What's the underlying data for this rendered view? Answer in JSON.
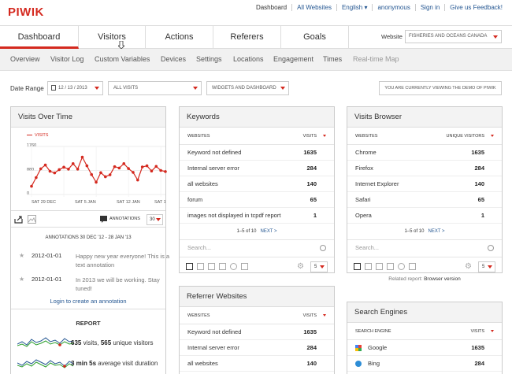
{
  "app": {
    "logo": "PIWIK"
  },
  "top_links": [
    "Dashboard",
    "All Websites",
    "English",
    "anonymous",
    "Sign in",
    "Give us Feedback!"
  ],
  "main_tabs": [
    "Dashboard",
    "Visitors",
    "Actions",
    "Referers",
    "Goals"
  ],
  "website": {
    "label": "Website",
    "value": "FISHERIES AND OCEANS CANADA"
  },
  "sub_tabs": [
    "Overview",
    "Visitor Log",
    "Custom Variables",
    "Devices",
    "Settings",
    "Locations",
    "Engagement",
    "Times",
    "Real-time Map"
  ],
  "date_range": {
    "label": "Date Range",
    "date": "12 / 13 / 2013",
    "segment": "ALL VISITS",
    "mode": "WIDGETS AND DASHBOARD",
    "demo_notice": "YOU ARE CURRENTLY VIEWING THE DEMO OF PIWIK"
  },
  "visits_over_time": {
    "title": "Visits Over Time",
    "annotations_label": "ANNOTATIONS",
    "period_value": "30",
    "annotations_title": "ANNOTATIONS 30 DEC '12 - 28 JAN '13",
    "annotations": [
      {
        "date": "2012-01-01",
        "text": "Happy new year everyone! This is a text annotation"
      },
      {
        "date": "2012-01-01",
        "text": "In 2013 we will be working. Stay tuned!"
      }
    ],
    "login_link": "Login to create an annotation",
    "report_title": "REPORT",
    "report_lines": [
      {
        "bold": "635",
        "text1": " visits, ",
        "bold2": "565",
        "text2": " unique visitors"
      },
      {
        "bold": "3 min 5s",
        "text1": " average visit duration",
        "bold2": "",
        "text2": ""
      }
    ]
  },
  "chart_data": {
    "type": "line",
    "x": [
      "SAT 29 DEC",
      "SAT 5 JAN",
      "SAT 12 JAN",
      "SAT 19 JAN"
    ],
    "series": [
      {
        "name": "VISITS",
        "values": [
          300,
          620,
          940,
          1080,
          850,
          790,
          910,
          1000,
          930,
          1130,
          930,
          1370,
          1050,
          730,
          450,
          800,
          650,
          720,
          1020,
          970,
          1130,
          950,
          810,
          530,
          1010,
          1050,
          860,
          1030,
          880,
          840
        ]
      }
    ],
    "yticks": [
      "1760",
      "880",
      "0"
    ],
    "ylim": [
      0,
      1760
    ],
    "color": "#d4291f",
    "grid": true
  },
  "keywords": {
    "title": "Keywords",
    "col1": "WEBSITES",
    "col2": "VISITS",
    "rows": [
      {
        "label": "Keyword not defined",
        "value": "1635"
      },
      {
        "label": "Internal server error",
        "value": "284"
      },
      {
        "label": "all websites",
        "value": "140"
      },
      {
        "label": "forum",
        "value": "65"
      },
      {
        "label": "images not displayed in tcpdf report",
        "value": "1"
      }
    ],
    "pager": "1–5 of 10",
    "next": "NEXT >",
    "search_placeholder": "Search...",
    "limit": "5"
  },
  "referrers": {
    "title": "Referrer Websites",
    "col1": "WEBSITES",
    "col2": "VISITS",
    "rows": [
      {
        "label": "Keyword not defined",
        "value": "1635"
      },
      {
        "label": "Internal server error",
        "value": "284"
      },
      {
        "label": "all websites",
        "value": "140"
      }
    ]
  },
  "browser": {
    "title": "Visits Browser",
    "col1": "WEBSITES",
    "col2": "UNIQUE VISITORS",
    "rows": [
      {
        "label": "Chrome",
        "value": "1635"
      },
      {
        "label": "Firefox",
        "value": "284"
      },
      {
        "label": "Internet Explorer",
        "value": "140"
      },
      {
        "label": "Safari",
        "value": "65"
      },
      {
        "label": "Opera",
        "value": "1"
      }
    ],
    "pager": "1–5 of 10",
    "next": "NEXT >",
    "search_placeholder": "Search...",
    "limit": "5",
    "related_label": "Related report:",
    "related_value": "Browser version"
  },
  "search_engines": {
    "title": "Search Engines",
    "col1": "SEARCH ENGINE",
    "col2": "VISITS",
    "rows": [
      {
        "label": "Google",
        "value": "1635"
      },
      {
        "label": "Bing",
        "value": "284"
      }
    ]
  }
}
